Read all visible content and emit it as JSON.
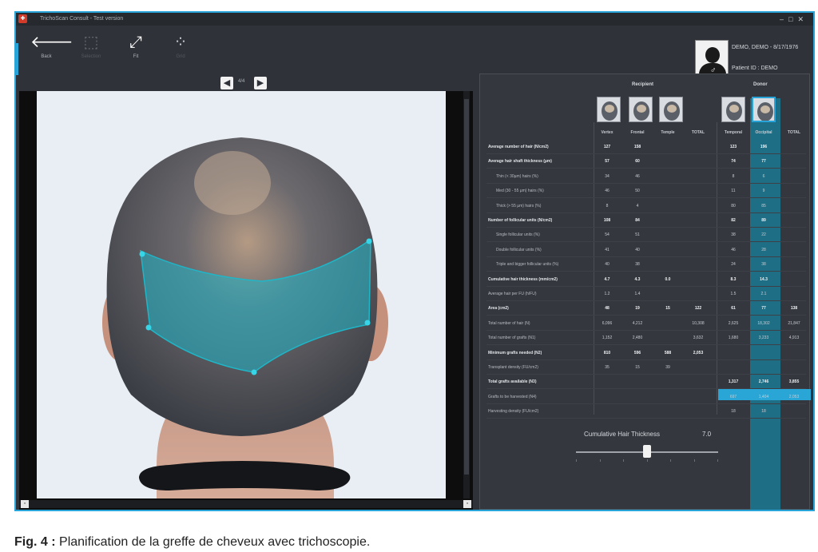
{
  "window": {
    "title": "TrichoScan Consult - Test version"
  },
  "toolbar": {
    "back_label": "Back",
    "tool2_label": "Selection",
    "tool3_label": "Fit",
    "tool4_label": "Grid"
  },
  "patient": {
    "name": "DEMO, DEMO - 8/17/1976",
    "id_line": "Patient ID : DEMO",
    "gender_symbol": "♂"
  },
  "navigation": {
    "page": "4/4"
  },
  "panel": {
    "recipient_header": "Recipient",
    "donor_header": "Donor",
    "columns": [
      "Vertex",
      "Frontal",
      "Temple",
      "TOTAL",
      "Temporal",
      "Occipital",
      "TOTAL"
    ],
    "rows": [
      {
        "label": "Average number of hair (N/cm2)",
        "bold": true,
        "indent": false,
        "values": [
          "127",
          "158",
          "",
          "",
          "123",
          "196",
          ""
        ]
      },
      {
        "label": "Average hair shaft thickness (µm)",
        "bold": true,
        "indent": false,
        "values": [
          "57",
          "60",
          "",
          "",
          "74",
          "77",
          ""
        ]
      },
      {
        "label": "Thin (< 30µm) hairs (%)",
        "bold": false,
        "indent": true,
        "values": [
          "34",
          "46",
          "",
          "",
          "8",
          "6",
          ""
        ]
      },
      {
        "label": "Med (30 - 55 µm) hairs (%)",
        "bold": false,
        "indent": true,
        "values": [
          "46",
          "50",
          "",
          "",
          "11",
          "9",
          ""
        ]
      },
      {
        "label": "Thick (> 55 µm) hairs (%)",
        "bold": false,
        "indent": true,
        "values": [
          "8",
          "4",
          "",
          "",
          "80",
          "85",
          ""
        ]
      },
      {
        "label": "Number of follicular units (N/cm2)",
        "bold": true,
        "indent": false,
        "values": [
          "108",
          "84",
          "",
          "",
          "82",
          "89",
          ""
        ]
      },
      {
        "label": "Single follicular units (%)",
        "bold": false,
        "indent": true,
        "values": [
          "54",
          "51",
          "",
          "",
          "38",
          "22",
          ""
        ]
      },
      {
        "label": "Double follicular units (%)",
        "bold": false,
        "indent": true,
        "values": [
          "41",
          "40",
          "",
          "",
          "46",
          "28",
          ""
        ]
      },
      {
        "label": "Triple and bigger follicular units (%)",
        "bold": false,
        "indent": true,
        "values": [
          "40",
          "38",
          "",
          "",
          "24",
          "38",
          ""
        ]
      },
      {
        "label": "Cumulative hair thickness (mm/cm2)",
        "bold": true,
        "indent": false,
        "values": [
          "4.7",
          "4.3",
          "0.0",
          "",
          "8.3",
          "14.3",
          ""
        ]
      },
      {
        "label": "Average hair per FU (h/FU)",
        "bold": false,
        "indent": false,
        "values": [
          "1.2",
          "1.4",
          "",
          "",
          "1.5",
          "2.1",
          ""
        ]
      },
      {
        "label": "Area (cm2)",
        "bold": true,
        "indent": false,
        "values": [
          "48",
          "19",
          "15",
          "122",
          "61",
          "77",
          "138"
        ]
      },
      {
        "label": "Total number of hair (N)",
        "bold": false,
        "indent": false,
        "values": [
          "6,096",
          "4,212",
          "",
          "10,308",
          "2,625",
          "18,302",
          "21,847"
        ]
      },
      {
        "label": "Total number of grafts (N1)",
        "bold": false,
        "indent": false,
        "values": [
          "1,152",
          "2,480",
          "",
          "3,632",
          "1,680",
          "3,233",
          "4,913"
        ]
      },
      {
        "label": "Minimum grafts needed (N2)",
        "bold": true,
        "indent": false,
        "values": [
          "810",
          "596",
          "588",
          "2,053",
          "",
          "",
          ""
        ]
      },
      {
        "label": "Transplant density (FU/cm2)",
        "bold": false,
        "indent": false,
        "values": [
          "35",
          "15",
          "39",
          "",
          "",
          "",
          ""
        ]
      },
      {
        "label": "Total grafts available (N3)",
        "bold": true,
        "indent": false,
        "values": [
          "",
          "",
          "",
          "",
          "1,317",
          "2,746",
          "3,855"
        ]
      },
      {
        "label": "Grafts to be harvested (N4)",
        "bold": false,
        "indent": false,
        "values": [
          "",
          "",
          "",
          "",
          "697",
          "1,404",
          "2,053"
        ]
      },
      {
        "label": "Harvesting density (FU/cm2)",
        "bold": false,
        "indent": false,
        "values": [
          "",
          "",
          "",
          "",
          "18",
          "18",
          ""
        ]
      }
    ],
    "slider": {
      "label": "Cumulative Hair Thickness",
      "value": "7.0",
      "level_fraction": 0.5
    }
  },
  "caption": {
    "bold_part": "Fig. 4 :",
    "text": "Planification de la greffe de cheveux avec trichoscopie."
  },
  "colors": {
    "accent": "#28a4d8",
    "donor_column": "#1e6f86",
    "overlay": "#1fb6c8"
  }
}
